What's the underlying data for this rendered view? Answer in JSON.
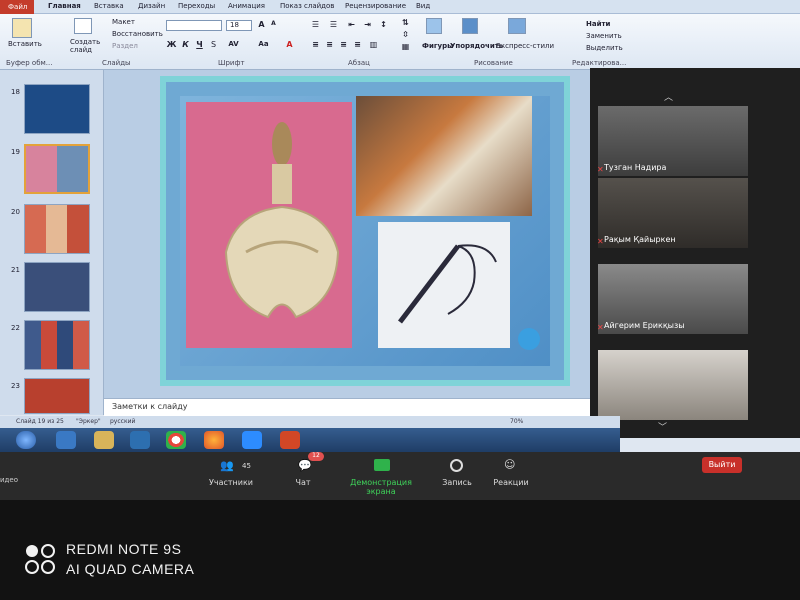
{
  "ribbon": {
    "file_tab": "Файл",
    "tabs": [
      "Главная",
      "Вставка",
      "Дизайн",
      "Переходы",
      "Анимация",
      "Показ слайдов",
      "Рецензирование",
      "Вид"
    ],
    "clipboard": {
      "paste": "Вставить",
      "label": "Буфер обм..."
    },
    "slides": {
      "new_slide": "Создать слайд",
      "layout": "Макет",
      "reset": "Восстановить",
      "section": "Раздел",
      "label": "Слайды"
    },
    "font": {
      "size": "18",
      "label": "Шрифт"
    },
    "paragraph": {
      "label": "Абзац"
    },
    "drawing": {
      "shapes": "Фигуры",
      "arrange": "Упорядочить",
      "quick_styles": "Экспресс-стили",
      "label": "Рисование"
    },
    "editing": {
      "find": "Найти",
      "replace": "Заменить",
      "select": "Выделить",
      "label": "Редактирова..."
    }
  },
  "slides_panel": {
    "thumbnails": [
      {
        "num": "18"
      },
      {
        "num": "19",
        "selected": true
      },
      {
        "num": "20"
      },
      {
        "num": "21"
      },
      {
        "num": "22"
      },
      {
        "num": "23"
      }
    ]
  },
  "notes": {
    "placeholder": "Заметки к слайду"
  },
  "statusbar": {
    "slide_info": "Слайд 19 из 25",
    "theme": "\"Эркер\"",
    "language": "русский",
    "zoom": "70%"
  },
  "zoom": {
    "participants_label": "Участники",
    "participants_count": "45",
    "chat_label": "Чат",
    "chat_badge": "12",
    "share_label": "Демонстрация экрана",
    "record_label": "Запись",
    "reactions_label": "Реакции",
    "leave_label": "Выйти",
    "video_label": "идео",
    "participants": [
      {
        "name": "Тузган Надира"
      },
      {
        "name": "Рақым Қайыркен"
      },
      {
        "name": "Айгерим Ерикқызы"
      },
      {
        "name": ""
      }
    ]
  },
  "watermark": {
    "line1": "REDMI NOTE 9S",
    "line2": "AI QUAD CAMERA"
  },
  "colors": {
    "accent_red": "#c8302a",
    "share_green": "#2fb24b",
    "frame_teal": "#7fd3d8"
  }
}
